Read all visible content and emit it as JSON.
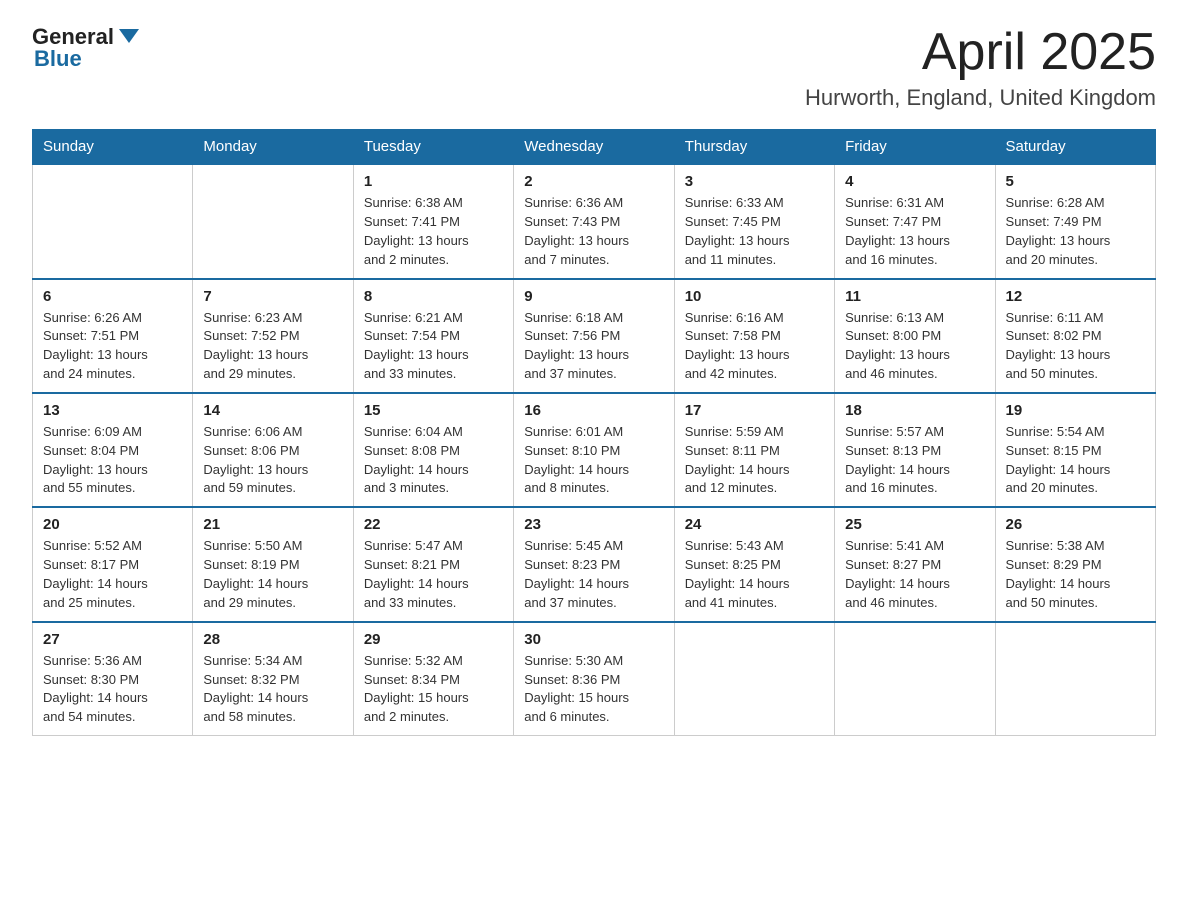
{
  "logo": {
    "general": "General",
    "blue": "Blue"
  },
  "title": "April 2025",
  "subtitle": "Hurworth, England, United Kingdom",
  "days_of_week": [
    "Sunday",
    "Monday",
    "Tuesday",
    "Wednesday",
    "Thursday",
    "Friday",
    "Saturday"
  ],
  "weeks": [
    [
      {
        "num": "",
        "info": ""
      },
      {
        "num": "",
        "info": ""
      },
      {
        "num": "1",
        "info": "Sunrise: 6:38 AM\nSunset: 7:41 PM\nDaylight: 13 hours\nand 2 minutes."
      },
      {
        "num": "2",
        "info": "Sunrise: 6:36 AM\nSunset: 7:43 PM\nDaylight: 13 hours\nand 7 minutes."
      },
      {
        "num": "3",
        "info": "Sunrise: 6:33 AM\nSunset: 7:45 PM\nDaylight: 13 hours\nand 11 minutes."
      },
      {
        "num": "4",
        "info": "Sunrise: 6:31 AM\nSunset: 7:47 PM\nDaylight: 13 hours\nand 16 minutes."
      },
      {
        "num": "5",
        "info": "Sunrise: 6:28 AM\nSunset: 7:49 PM\nDaylight: 13 hours\nand 20 minutes."
      }
    ],
    [
      {
        "num": "6",
        "info": "Sunrise: 6:26 AM\nSunset: 7:51 PM\nDaylight: 13 hours\nand 24 minutes."
      },
      {
        "num": "7",
        "info": "Sunrise: 6:23 AM\nSunset: 7:52 PM\nDaylight: 13 hours\nand 29 minutes."
      },
      {
        "num": "8",
        "info": "Sunrise: 6:21 AM\nSunset: 7:54 PM\nDaylight: 13 hours\nand 33 minutes."
      },
      {
        "num": "9",
        "info": "Sunrise: 6:18 AM\nSunset: 7:56 PM\nDaylight: 13 hours\nand 37 minutes."
      },
      {
        "num": "10",
        "info": "Sunrise: 6:16 AM\nSunset: 7:58 PM\nDaylight: 13 hours\nand 42 minutes."
      },
      {
        "num": "11",
        "info": "Sunrise: 6:13 AM\nSunset: 8:00 PM\nDaylight: 13 hours\nand 46 minutes."
      },
      {
        "num": "12",
        "info": "Sunrise: 6:11 AM\nSunset: 8:02 PM\nDaylight: 13 hours\nand 50 minutes."
      }
    ],
    [
      {
        "num": "13",
        "info": "Sunrise: 6:09 AM\nSunset: 8:04 PM\nDaylight: 13 hours\nand 55 minutes."
      },
      {
        "num": "14",
        "info": "Sunrise: 6:06 AM\nSunset: 8:06 PM\nDaylight: 13 hours\nand 59 minutes."
      },
      {
        "num": "15",
        "info": "Sunrise: 6:04 AM\nSunset: 8:08 PM\nDaylight: 14 hours\nand 3 minutes."
      },
      {
        "num": "16",
        "info": "Sunrise: 6:01 AM\nSunset: 8:10 PM\nDaylight: 14 hours\nand 8 minutes."
      },
      {
        "num": "17",
        "info": "Sunrise: 5:59 AM\nSunset: 8:11 PM\nDaylight: 14 hours\nand 12 minutes."
      },
      {
        "num": "18",
        "info": "Sunrise: 5:57 AM\nSunset: 8:13 PM\nDaylight: 14 hours\nand 16 minutes."
      },
      {
        "num": "19",
        "info": "Sunrise: 5:54 AM\nSunset: 8:15 PM\nDaylight: 14 hours\nand 20 minutes."
      }
    ],
    [
      {
        "num": "20",
        "info": "Sunrise: 5:52 AM\nSunset: 8:17 PM\nDaylight: 14 hours\nand 25 minutes."
      },
      {
        "num": "21",
        "info": "Sunrise: 5:50 AM\nSunset: 8:19 PM\nDaylight: 14 hours\nand 29 minutes."
      },
      {
        "num": "22",
        "info": "Sunrise: 5:47 AM\nSunset: 8:21 PM\nDaylight: 14 hours\nand 33 minutes."
      },
      {
        "num": "23",
        "info": "Sunrise: 5:45 AM\nSunset: 8:23 PM\nDaylight: 14 hours\nand 37 minutes."
      },
      {
        "num": "24",
        "info": "Sunrise: 5:43 AM\nSunset: 8:25 PM\nDaylight: 14 hours\nand 41 minutes."
      },
      {
        "num": "25",
        "info": "Sunrise: 5:41 AM\nSunset: 8:27 PM\nDaylight: 14 hours\nand 46 minutes."
      },
      {
        "num": "26",
        "info": "Sunrise: 5:38 AM\nSunset: 8:29 PM\nDaylight: 14 hours\nand 50 minutes."
      }
    ],
    [
      {
        "num": "27",
        "info": "Sunrise: 5:36 AM\nSunset: 8:30 PM\nDaylight: 14 hours\nand 54 minutes."
      },
      {
        "num": "28",
        "info": "Sunrise: 5:34 AM\nSunset: 8:32 PM\nDaylight: 14 hours\nand 58 minutes."
      },
      {
        "num": "29",
        "info": "Sunrise: 5:32 AM\nSunset: 8:34 PM\nDaylight: 15 hours\nand 2 minutes."
      },
      {
        "num": "30",
        "info": "Sunrise: 5:30 AM\nSunset: 8:36 PM\nDaylight: 15 hours\nand 6 minutes."
      },
      {
        "num": "",
        "info": ""
      },
      {
        "num": "",
        "info": ""
      },
      {
        "num": "",
        "info": ""
      }
    ]
  ]
}
